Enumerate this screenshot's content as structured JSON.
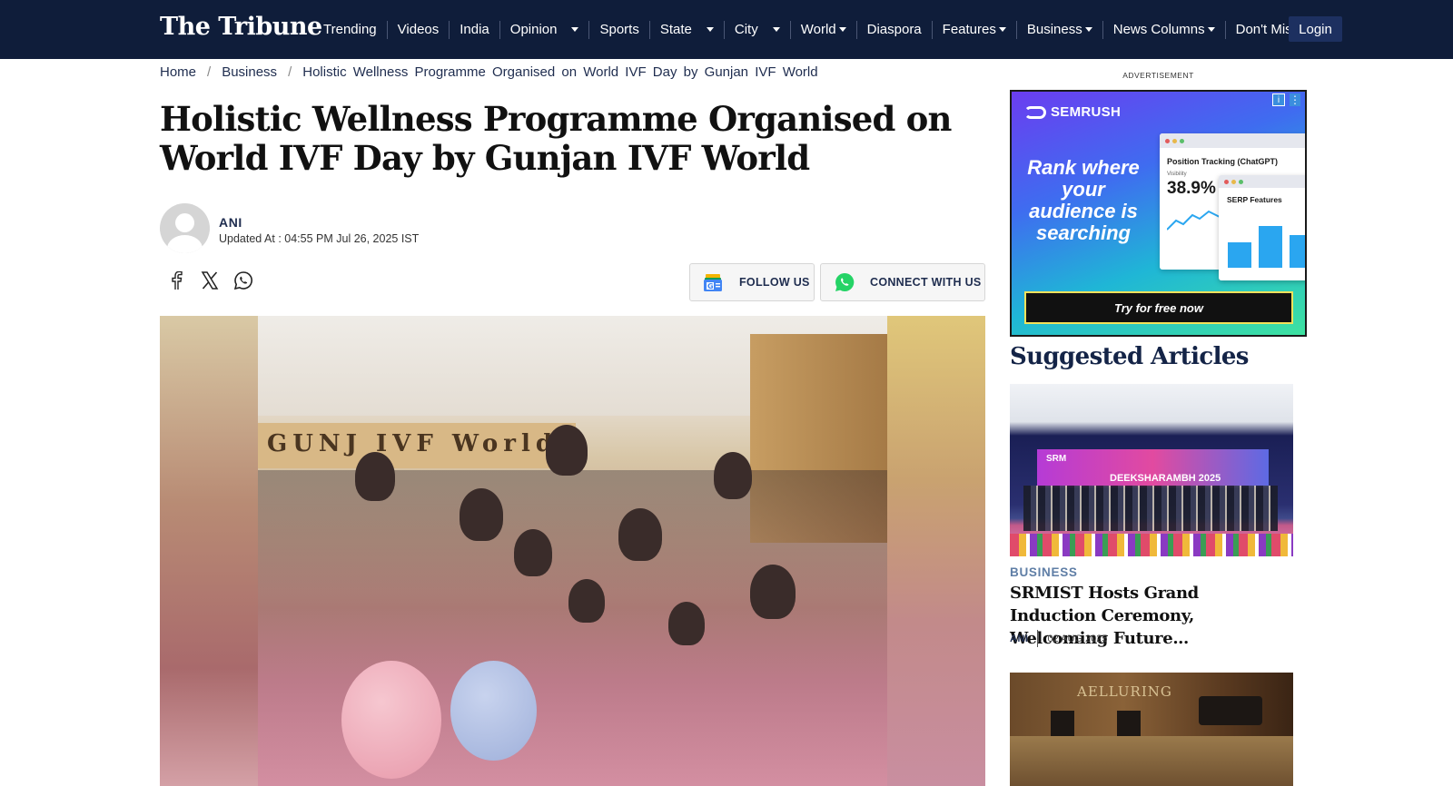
{
  "site": {
    "logo": "The Tribune"
  },
  "nav": {
    "items": [
      {
        "label": "Trending",
        "caret": false
      },
      {
        "label": "Videos",
        "caret": false
      },
      {
        "label": "India",
        "caret": false
      },
      {
        "label": "Opinion",
        "caret": true
      },
      {
        "label": "Sports",
        "caret": false
      },
      {
        "label": "State",
        "caret": true
      },
      {
        "label": "City",
        "caret": true
      },
      {
        "label": "World",
        "caret": true
      },
      {
        "label": "Diaspora",
        "caret": false
      },
      {
        "label": "Features",
        "caret": true
      },
      {
        "label": "Business",
        "caret": true
      },
      {
        "label": "News Columns",
        "caret": true
      },
      {
        "label": "Don't Miss",
        "caret": false
      }
    ],
    "login": "Login"
  },
  "breadcrumb": {
    "home": "Home",
    "section": "Business",
    "current": "Holistic Wellness Programme Organised on World IVF Day by Gunjan IVF World",
    "separator": "/"
  },
  "article": {
    "title": "Holistic Wellness Programme Organised on World IVF Day by Gunjan IVF World",
    "author": "ANI",
    "updated": "Updated At : 04:55 PM Jul 26, 2025 IST",
    "follow_label": "FOLLOW US",
    "connect_label": "CONNECT WITH US",
    "image_sign_text": "GUNJ  IVF World"
  },
  "share_icons": [
    "facebook-icon",
    "x-icon",
    "whatsapp-icon"
  ],
  "ad": {
    "label": "ADVERTISEMENT",
    "brand": "SEMRUSH",
    "copy": "Rank where your audience is searching",
    "card1_title": "Position Tracking (ChatGPT)",
    "card1_sub": "Visibility",
    "card1_value": "38.9%",
    "card2_title": "SERP Features",
    "cta": "Try for free now"
  },
  "suggested": {
    "title": "Suggested Articles",
    "items": [
      {
        "category": "BUSINESS",
        "headline": "SRMIST Hosts Grand Induction Ceremony, Welcoming Future...",
        "author": "ANI",
        "date": "02 AUG 2025",
        "image_text_1": "SRM",
        "image_text_2": "DEEKSHARAMBH 2025"
      },
      {
        "image_text_1": "AELLURING"
      }
    ]
  },
  "colors": {
    "nav_bg": "#0f1d3a",
    "login_bg": "#1d3060",
    "category": "#5f7ea6",
    "title_navy": "#142447"
  }
}
